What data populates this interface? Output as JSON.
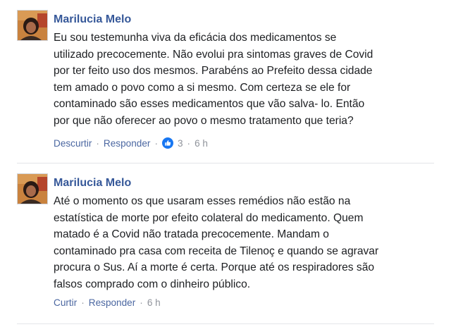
{
  "comments": [
    {
      "author": "Marilucia Melo",
      "text": "Eu sou testemunha viva da eficácia dos medicamentos se\nutilizado precocemente. Não evolui pra sintomas graves de Covid\npor ter feito uso dos mesmos. Parabéns ao Prefeito dessa cidade\ntem amado o povo como a si mesmo. Com certeza se ele for\ncontaminado são esses medicamentos que vão salva- lo. Então\npor que não oferecer ao povo o mesmo tratamento que teria?",
      "actions": {
        "like_label": "Descurtir",
        "reply_label": "Responder",
        "sep": "·",
        "reaction_icon": "thumbs-up-icon",
        "reaction_count": "3",
        "timestamp": "6 h"
      }
    },
    {
      "author": "Marilucia Melo",
      "text": "Até o momento os que usaram esses remédios não estão na\nestatística de morte por efeito colateral do medicamento. Quem\nmatado é a Covid não tratada precocemente. Mandam o\ncontaminado pra casa com receita de Tilenoç e quando se agravar\nprocura o Sus. Aí a morte é certa. Porque até os respiradores são\nfalsos comprado com o dinheiro público.",
      "actions": {
        "like_label": "Curtir",
        "reply_label": "Responder",
        "sep": "·",
        "timestamp": "6 h"
      }
    }
  ],
  "colors": {
    "author": "#365899",
    "link": "#4b67a1",
    "meta": "#90949c",
    "text": "#1c1e21",
    "like_badge": "#1877f2"
  }
}
